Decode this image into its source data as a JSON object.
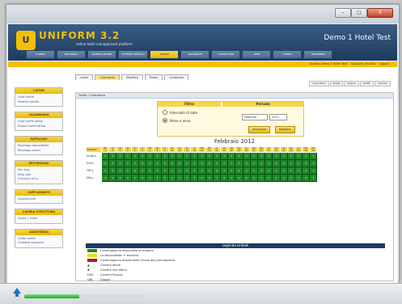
{
  "header": {
    "logo": "U",
    "brand": "UNIFORM 3.2",
    "subtitle": "online hotel management platform",
    "hotel": "Demo 1 Hotel Test"
  },
  "nav": [
    "CLIENTI",
    "BOOKINGS",
    "PIANIFICAZIONE",
    "OFFERTE SPECIALI",
    "TARIFFE",
    "PAGAMENTI",
    "STATISTICHE",
    "WEB",
    "UTENTI",
    "STRUMENTI"
  ],
  "nav_active": 4,
  "userbar": [
    "Utente: Demo 1 Hotel Test",
    "Supporto Tecnico",
    "Logout"
  ],
  "tabs": [
    "Listini",
    "Calendario",
    "Modifica",
    "Prezzi",
    "Condizioni"
  ],
  "tab_active": 1,
  "subtabs": [
    "Calendario",
    "Prezzi",
    "Regole",
    "Tariffe",
    "Inserisci"
  ],
  "sidebar": [
    {
      "title": "LISTINI",
      "links": [
        "Lista tariffe",
        "Modifica tariffe"
      ]
    },
    {
      "title": "CALENDARIO",
      "links": [
        "Lista tariffe attive",
        "Nuova tariffa attiva"
      ]
    },
    {
      "title": "RIEPILOGO",
      "links": [
        "Riepilogo disponibilita",
        "Riepilogo prezzi"
      ]
    },
    {
      "title": "RESTRIZIONI",
      "links": [
        "Min stay",
        "Stop sale",
        "Chiusura arrivi"
      ]
    },
    {
      "title": "SUPPLEMENTI",
      "links": [
        "Supplementi"
      ]
    },
    {
      "title": "CAMBIA STRUTTURA",
      "links": [
        "Demo 1 Hotel"
      ]
    },
    {
      "title": "ASSISTENZA",
      "links": [
        "Guida tariffe",
        "Contatta supporto"
      ]
    }
  ],
  "breadcrumb": "Tariffe / Calendario",
  "filters": {
    "title_left": "Filtro",
    "title_right": "Periodo",
    "radio1": "Intervallo di date",
    "radio2": "Mese e anno",
    "month": "Febbraio",
    "year": "2012",
    "btn_show": "Visualizza",
    "btn_edit": "Modifica"
  },
  "calendar": {
    "title": "Febbraio 2012",
    "label_header": "Camere",
    "weekdays": [
      "Me",
      "Gi",
      "Ve",
      "Sa",
      "Do",
      "Lu",
      "Ma",
      "Me",
      "Gi",
      "Ve",
      "Sa",
      "Do",
      "Lu",
      "Ma",
      "Me",
      "Gi",
      "Ve",
      "Sa",
      "Do",
      "Lu",
      "Ma",
      "Me",
      "Gi",
      "Ve",
      "Sa",
      "Do",
      "Lu",
      "Ma",
      "Me"
    ],
    "days": [
      "1",
      "2",
      "3",
      "4",
      "5",
      "6",
      "7",
      "8",
      "9",
      "10",
      "11",
      "12",
      "13",
      "14",
      "15",
      "16",
      "17",
      "18",
      "19",
      "20",
      "21",
      "22",
      "23",
      "24",
      "25",
      "26",
      "27",
      "28",
      "29"
    ],
    "rooms": [
      {
        "code": "QUAD",
        "values": [
          "3",
          "3",
          "3",
          "3",
          "3",
          "3",
          "3",
          "3",
          "3",
          "3",
          "3",
          "3",
          "3",
          "3",
          "3",
          "3",
          "3",
          "3",
          "3",
          "3",
          "3",
          "3",
          "3",
          "3",
          "3",
          "3",
          "3",
          "3",
          "3"
        ]
      },
      {
        "code": "DUS",
        "values": [
          "3",
          "3",
          "3",
          "3",
          "3",
          "3",
          "3",
          "3",
          "3",
          "3",
          "3",
          "3",
          "3",
          "3",
          "3",
          "3",
          "3",
          "3",
          "3",
          "3",
          "3",
          "3",
          "3",
          "3",
          "3",
          "3",
          "3",
          "3",
          "3"
        ]
      },
      {
        "code": "TRP",
        "values": [
          "3",
          "3",
          "3",
          "3",
          "3",
          "3",
          "3",
          "3",
          "3",
          "3",
          "3",
          "3",
          "3",
          "3",
          "3",
          "3",
          "3",
          "3",
          "3",
          "3",
          "3",
          "3",
          "3",
          "3",
          "3",
          "3",
          "3",
          "3",
          "3"
        ]
      },
      {
        "code": "DBL",
        "values": [
          "3",
          "3",
          "3",
          "3",
          "3",
          "3",
          "3",
          "3",
          "3",
          "3",
          "3",
          "3",
          "3",
          "3",
          "3",
          "3",
          "3",
          "3",
          "3",
          "3",
          "3",
          "3",
          "3",
          "3",
          "3",
          "3",
          "3",
          "3",
          "3"
        ]
      }
    ]
  },
  "legend": {
    "title": "Legenda simboli",
    "items": [
      {
        "color": "#1f8a2a",
        "code": "",
        "text": "Camera/giorno disponibile al pubblico"
      },
      {
        "color": "#e3e600",
        "code": "",
        "text": "La disponibilita' e' esaurita"
      },
      {
        "color": "#b01a1a",
        "code": "",
        "text": "Camera/giorno attualmente chiusa alla prenotazione"
      },
      {
        "color": "",
        "code": "▲",
        "text": "Camera attiva"
      },
      {
        "color": "",
        "code": "▼",
        "text": "Camera non attiva"
      },
      {
        "color": "",
        "code": "DUS",
        "text": "Camera Singola"
      },
      {
        "color": "",
        "code": "DBL",
        "text": "Doppia"
      },
      {
        "color": "",
        "code": "QUAD",
        "text": "Camera Quadrupla"
      },
      {
        "color": "",
        "code": "TRP",
        "text": "Camera Tripla"
      }
    ]
  },
  "window_buttons": [
    "–",
    "□",
    "X"
  ],
  "download_progress": 0.45
}
